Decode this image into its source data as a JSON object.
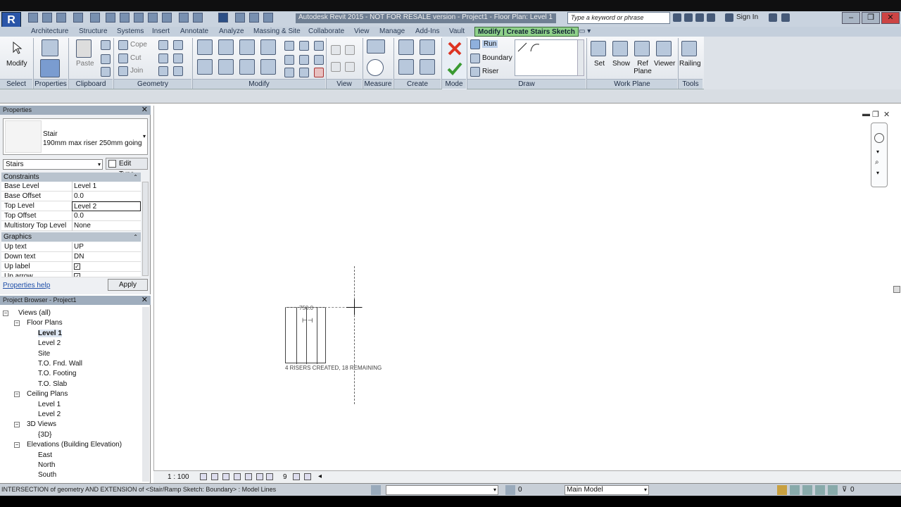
{
  "titlebar": {
    "app_title": "Autodesk Revit 2015 - NOT FOR RESALE version - Project1 - Floor Plan: Level 1",
    "search_placeholder": "Type a keyword or phrase",
    "sign_in": "Sign In",
    "logo": "R"
  },
  "tabs": [
    "Architecture",
    "Structure",
    "Systems",
    "Insert",
    "Annotate",
    "Analyze",
    "Massing & Site",
    "Collaborate",
    "View",
    "Manage",
    "Add-Ins",
    "Vault"
  ],
  "active_tab": "Modify | Create Stairs Sketch",
  "ribbon": {
    "modify_label": "Modify",
    "select_panel": "Select",
    "properties_panel": "Properties",
    "clipboard_panel": "Clipboard",
    "paste_label": "Paste",
    "geometry_panel": "Geometry",
    "cope_label": "Cope",
    "cut_label": "Cut",
    "join_label": "Join",
    "modify_panel": "Modify",
    "view_panel": "View",
    "measure_panel": "Measure",
    "create_panel": "Create",
    "mode_panel": "Mode",
    "draw_panel": "Draw",
    "run_label": "Run",
    "boundary_label": "Boundary",
    "riser_label": "Riser",
    "workplane_panel": "Work Plane",
    "set_label": "Set",
    "show_label": "Show",
    "refplane_label": "Ref Plane",
    "viewer_label": "Viewer",
    "tools_panel": "Tools",
    "railing_label": "Railing"
  },
  "properties": {
    "title": "Properties",
    "type_family": "Stair",
    "type_name": "190mm max riser 250mm going",
    "instance_filter": "Stairs",
    "edit_type": "Edit Type",
    "sections": {
      "constraints": "Constraints",
      "graphics": "Graphics"
    },
    "constraints": [
      {
        "key": "Base Level",
        "value": "Level 1"
      },
      {
        "key": "Base Offset",
        "value": "0.0"
      },
      {
        "key": "Top Level",
        "value": "Level 2"
      },
      {
        "key": "Top Offset",
        "value": "0.0"
      },
      {
        "key": "Multistory Top Level",
        "value": "None"
      }
    ],
    "graphics": [
      {
        "key": "Up text",
        "value": "UP"
      },
      {
        "key": "Down text",
        "value": "DN"
      },
      {
        "key": "Up label",
        "value": "✓"
      },
      {
        "key": "Up arrow",
        "value": "✓"
      }
    ],
    "help": "Properties help",
    "apply": "Apply"
  },
  "browser": {
    "title": "Project Browser - Project1",
    "items": [
      {
        "label": "Views (all)",
        "level": 0,
        "toggle": "−"
      },
      {
        "label": "Floor Plans",
        "level": 1,
        "toggle": "−"
      },
      {
        "label": "Level 1",
        "level": 2,
        "toggle": ""
      },
      {
        "label": "Level 2",
        "level": 2,
        "toggle": ""
      },
      {
        "label": "Site",
        "level": 2,
        "toggle": ""
      },
      {
        "label": "T.O. Fnd. Wall",
        "level": 2,
        "toggle": ""
      },
      {
        "label": "T.O. Footing",
        "level": 2,
        "toggle": ""
      },
      {
        "label": "T.O. Slab",
        "level": 2,
        "toggle": ""
      },
      {
        "label": "Ceiling Plans",
        "level": 1,
        "toggle": "−"
      },
      {
        "label": "Level 1",
        "level": 2,
        "toggle": ""
      },
      {
        "label": "Level 2",
        "level": 2,
        "toggle": ""
      },
      {
        "label": "3D Views",
        "level": 1,
        "toggle": "−"
      },
      {
        "label": "{3D}",
        "level": 2,
        "toggle": ""
      },
      {
        "label": "Elevations (Building Elevation)",
        "level": 1,
        "toggle": "−"
      },
      {
        "label": "East",
        "level": 2,
        "toggle": ""
      },
      {
        "label": "North",
        "level": 2,
        "toggle": ""
      },
      {
        "label": "South",
        "level": 2,
        "toggle": ""
      }
    ]
  },
  "canvas": {
    "stair_width": "750.0",
    "riser_status": "4 RISERS CREATED, 18 REMAINING",
    "treads_created": 4
  },
  "viewbar": {
    "scale": "1 : 100",
    "detail_number": "9"
  },
  "statusbar": {
    "hint": "INTERSECTION of geometry AND EXTENSION of <Stair/Ramp Sketch: Boundary> : Model Lines",
    "model": "Main Model",
    "filter_count": "0"
  },
  "colors": {
    "active_tab": "#8fd18a",
    "title_bg": "#0f0f10",
    "ribbon_panel": "#c9d3de"
  }
}
